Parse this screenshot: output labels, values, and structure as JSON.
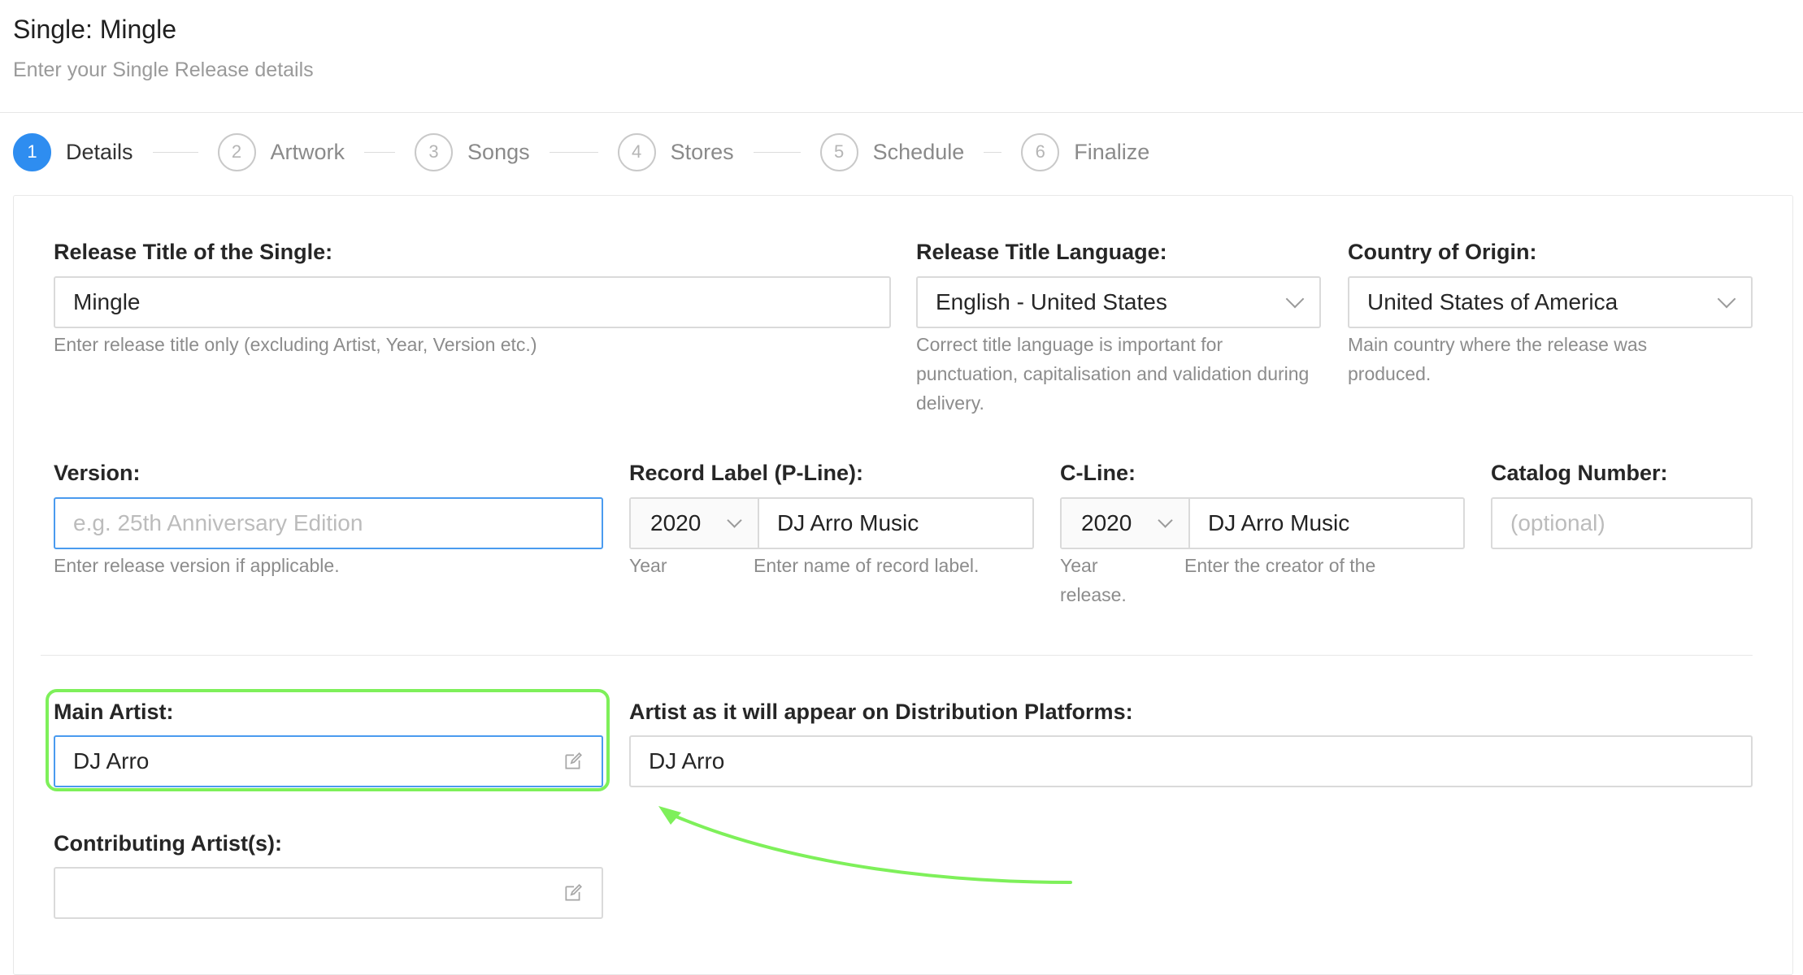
{
  "header": {
    "title": "Single: Mingle",
    "subtitle": "Enter your Single Release details"
  },
  "steps": [
    {
      "number": "1",
      "label": "Details",
      "active": true
    },
    {
      "number": "2",
      "label": "Artwork"
    },
    {
      "number": "3",
      "label": "Songs"
    },
    {
      "number": "4",
      "label": "Stores"
    },
    {
      "number": "5",
      "label": "Schedule"
    },
    {
      "number": "6",
      "label": "Finalize"
    }
  ],
  "form": {
    "release_title": {
      "label": "Release Title of the Single:",
      "value": "Mingle",
      "help": "Enter release title only (excluding Artist, Year, Version etc.)"
    },
    "title_language": {
      "label": "Release Title Language:",
      "value": "English - United States",
      "help": "Correct title language is important for punctuation, capitalisation and validation during delivery."
    },
    "country": {
      "label": "Country of Origin:",
      "value": "United States of America",
      "help": "Main country where the release was produced."
    },
    "version": {
      "label": "Version:",
      "placeholder": "e.g. 25th Anniversary Edition",
      "help": "Enter release version if applicable."
    },
    "record_label": {
      "label": "Record Label (P-Line):",
      "year": "2020",
      "name": "DJ Arro Music",
      "help_year": "Year",
      "help_name": "Enter name of record label."
    },
    "c_line": {
      "label": "C-Line:",
      "year": "2020",
      "name": "DJ Arro Music",
      "help_year": "Year",
      "help_year_2": "release.",
      "help_name": "Enter the creator of the"
    },
    "catalog": {
      "label": "Catalog Number:",
      "placeholder": "(optional)"
    },
    "main_artist": {
      "label": "Main Artist:",
      "value": "DJ Arro"
    },
    "distribution_artist": {
      "label": "Artist as it will appear on Distribution Platforms:",
      "value": "DJ Arro"
    },
    "contributing": {
      "label": "Contributing Artist(s):",
      "value": ""
    }
  },
  "colors": {
    "accent": "#2e8df0",
    "focus_border": "#4a9bef",
    "annotation": "#7ef05a"
  },
  "icons": {
    "edit": "pencil-square-icon",
    "dropdown": "chevron-down-icon"
  }
}
